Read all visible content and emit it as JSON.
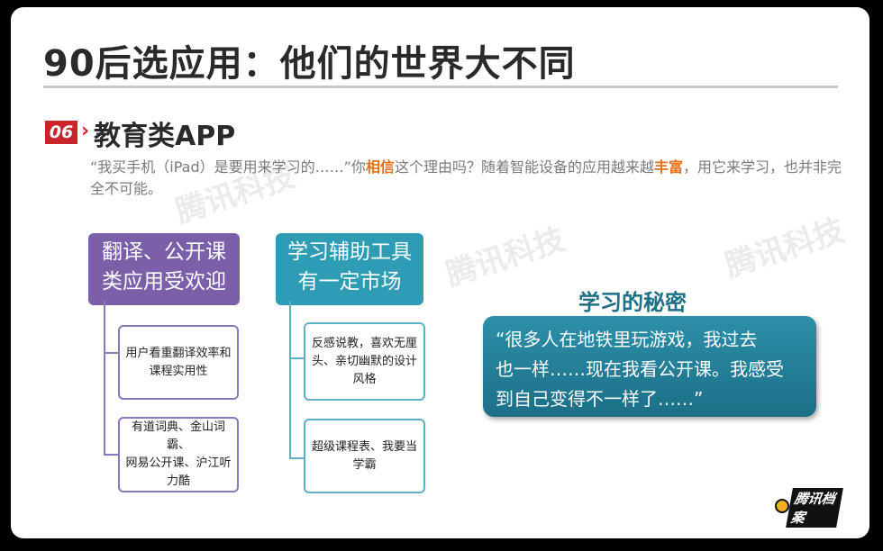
{
  "title": "90后选应用：他们的世界大不同",
  "section": {
    "number": "06",
    "title": "教育类APP"
  },
  "intro": {
    "part1": "“我买手机（iPad）是要用来学习的……”你",
    "highlight1": "相信",
    "part2": "这个理由吗？随着智能设备的应用越来越",
    "highlight2": "丰富",
    "part3": "，用它来学习，也并非完全不可能。",
    "highlight_color": "#e8701c"
  },
  "categories": [
    {
      "line1": "翻译、公开课",
      "line2": "类应用受欢迎",
      "color": "#7b5fa9",
      "cards": [
        {
          "lines": [
            "用户看重翻译效率和",
            "课程实用性"
          ]
        },
        {
          "lines": [
            "有道词典、金山词霸、",
            "网易公开课、沪江听",
            "力酷"
          ]
        }
      ]
    },
    {
      "line1": "学习辅助工具",
      "line2": "有一定市场",
      "color": "#2f9cb5",
      "cards": [
        {
          "lines": [
            "反感说教，喜欢无厘",
            "头、亲切幽默的设计",
            "风格"
          ]
        },
        {
          "lines": [
            "超级课程表、我要当",
            "学霸"
          ]
        }
      ]
    }
  ],
  "secret": {
    "title": "学习的秘密",
    "quote_lines": [
      "“很多人在地铁里玩游戏，我过去",
      "也一样……现在我看公开课。我感受",
      "到自己变得不一样了……”"
    ]
  },
  "watermark_text": "腾讯科技",
  "logo_text": "腾讯档案"
}
